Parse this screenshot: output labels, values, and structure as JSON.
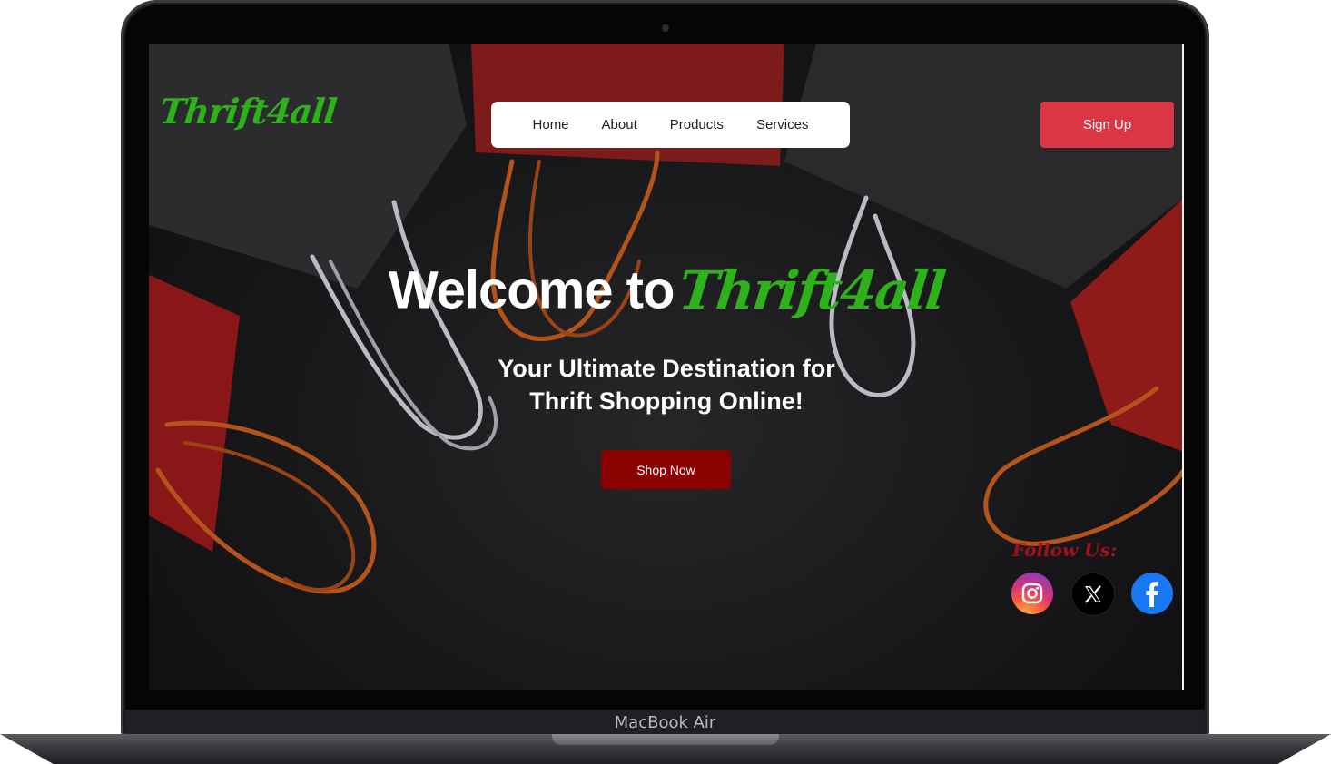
{
  "device": {
    "label": "MacBook Air"
  },
  "site": {
    "logo": "Thrift4all",
    "nav": [
      {
        "label": "Home"
      },
      {
        "label": "About"
      },
      {
        "label": "Products"
      },
      {
        "label": "Services"
      }
    ],
    "signup_label": "Sign Up"
  },
  "hero": {
    "title_prefix": "Welcome to",
    "title_brand": "Thrift4all",
    "tagline_line1": "Your Ultimate Destination for",
    "tagline_line2": "Thrift Shopping Online!",
    "cta_label": "Shop Now"
  },
  "social": {
    "label": "Follow Us:",
    "icons": [
      "instagram-icon",
      "x-icon",
      "facebook-icon"
    ]
  },
  "colors": {
    "brand_green": "#2fb11c",
    "signup_red": "#dc3546",
    "cta_dark_red": "#8b0000",
    "follow_red": "#a4101a"
  }
}
